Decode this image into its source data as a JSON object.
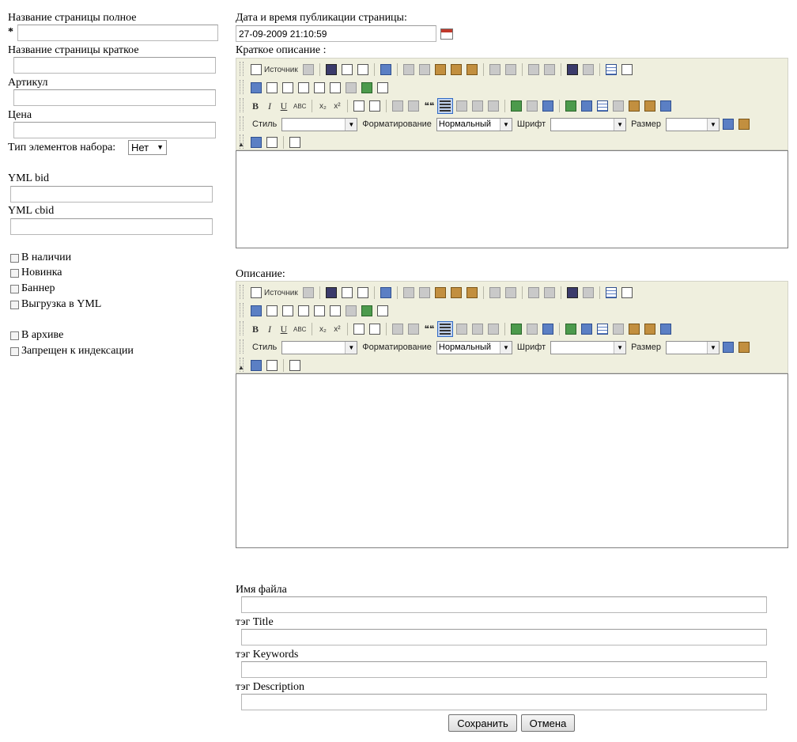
{
  "left": {
    "full_name_label": "Название страницы полное",
    "required_mark": "*",
    "short_name_label": "Название страницы краткое",
    "article_label": "Артикул",
    "price_label": "Цена",
    "set_type_label": "Тип элементов набора:",
    "set_type_value": "Нет",
    "yml_bid_label": "YML bid",
    "yml_cbid_label": "YML cbid",
    "checkboxes_group1": [
      "В наличии",
      "Новинка",
      "Баннер",
      "Выгрузка в YML"
    ],
    "checkboxes_group2": [
      "В архиве",
      "Запрещен к индексации"
    ]
  },
  "publish": {
    "label": "Дата и время публикации страницы:",
    "value": "27-09-2009 21:10:59"
  },
  "editor_short": {
    "label": "Краткое описание :"
  },
  "editor_full": {
    "label": "Описание:"
  },
  "toolbar": {
    "source_label": "Источник",
    "style_label": "Стиль",
    "format_label": "Форматирование",
    "format_value": "Нормальный",
    "font_label": "Шрифт",
    "size_label": "Размер",
    "bold": "B",
    "italic": "I",
    "underline": "U",
    "strike": "ABC",
    "sub": "x₂",
    "sup": "x²",
    "quote": "❝❝"
  },
  "seo": {
    "filename_label": "Имя файла",
    "title_label": "тэг Title",
    "keywords_label": "тэг Keywords",
    "description_label": "тэг Description"
  },
  "buttons": {
    "save": "Сохранить",
    "cancel": "Отмена"
  }
}
